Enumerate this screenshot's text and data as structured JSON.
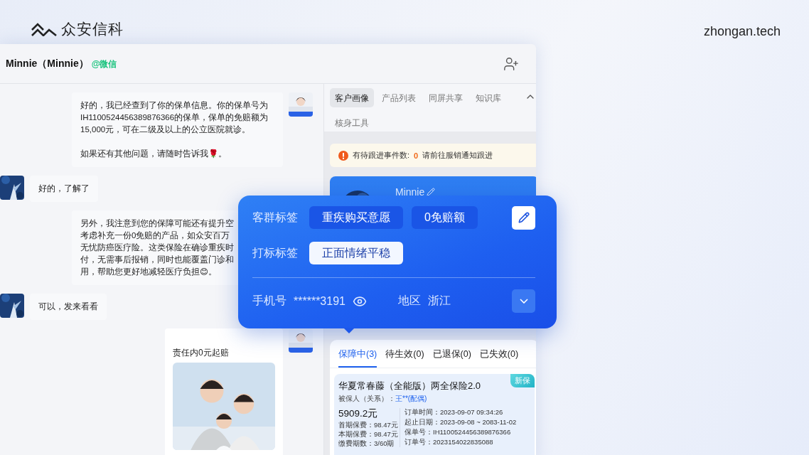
{
  "brand": {
    "logo_text": "众安信科",
    "domain": "zhongan.tech"
  },
  "chat": {
    "contact_name": "Minnie（Minnie）",
    "channel": "@微信",
    "messages": [
      {
        "outgoing": true,
        "avatar": true,
        "kind": "text",
        "paragraphs": [
          [
            "好的，我已经查到了你的保单信息。你的保单号为",
            "IH1100524456389876366的保单，保单的免赔额为",
            "15,000元，可在二级及以上的公立医院就诊。"
          ],
          [
            "如果还有其他问题，请随时告诉我🌹。"
          ]
        ]
      },
      {
        "outgoing": false,
        "avatar": true,
        "kind": "text",
        "paragraphs": [
          [
            "好的，了解了"
          ]
        ]
      },
      {
        "outgoing": true,
        "kind": "text",
        "paragraphs": [
          [
            "另外，我注意到您的保障可能还有提升空",
            "考虑补充一份0免赔的产品，如众安百万",
            "无忧防癌医疗险。这类保险在确诊重疾时",
            "付，无需事后报销，同时也能覆盖门诊和",
            "用，帮助您更好地减轻医疗负担😊。"
          ]
        ]
      },
      {
        "outgoing": false,
        "avatar": true,
        "kind": "text",
        "paragraphs": [
          [
            "可以，发来看看"
          ]
        ]
      },
      {
        "outgoing": true,
        "avatar": true,
        "kind": "card",
        "title": "责任内0元起赔"
      }
    ]
  },
  "panel": {
    "tabs": [
      {
        "label": "客户画像",
        "selected": true
      },
      {
        "label": "产品列表",
        "selected": false
      },
      {
        "label": "同屏共享",
        "selected": false
      },
      {
        "label": "知识库",
        "selected": false
      },
      {
        "label": "核身工具",
        "selected": false
      }
    ],
    "alert": {
      "label": "有待跟进事件数:",
      "count": "0",
      "hint": "请前往服销通知跟进"
    },
    "profile": {
      "name": "Minnie"
    },
    "popup": {
      "tag_groups": [
        {
          "label": "客群标签",
          "tags": [
            {
              "text": "重疾购买意愿",
              "kind": "solid"
            },
            {
              "text": "0免赔额",
              "kind": "solid"
            }
          ]
        },
        {
          "label": "打标标签",
          "tags": [
            {
              "text": "正面情绪平稳",
              "kind": "light"
            }
          ]
        }
      ],
      "phone_label": "手机号",
      "phone": "******3191",
      "region_label": "地区",
      "region": "浙江"
    },
    "policy_tabs": [
      {
        "label": "保障中(3)",
        "selected": true
      },
      {
        "label": "待生效(0)",
        "selected": false
      },
      {
        "label": "已退保(0)",
        "selected": false
      },
      {
        "label": "已失效(0)",
        "selected": false
      }
    ],
    "policy": {
      "title": "华夏常春藤（全能版）两全保险2.0",
      "badge": "新保",
      "insured_label": "被保人（关系）：",
      "insured": "王**(配偶)",
      "amount": "5909.2元",
      "left_rows": [
        "首期保费：98.47元",
        "本期保费：98.47元",
        "缴费期数：3/60期"
      ],
      "right_rows": [
        "订单时间：2023-09-07 09:34:26",
        "起止日期：2023-09-08 ~ 2083-11-02",
        "保单号：IH1100524456389876366",
        "订单号：2023154022835088"
      ]
    }
  }
}
